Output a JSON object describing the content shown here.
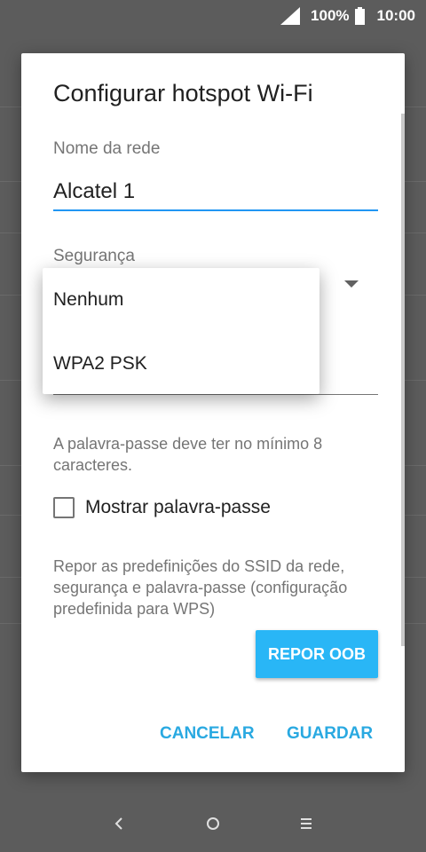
{
  "status_bar": {
    "battery_percent": "100%",
    "time": "10:00",
    "icons": [
      "signal-icon",
      "battery-icon"
    ]
  },
  "dialog": {
    "title": "Configurar hotspot Wi-Fi",
    "network_name": {
      "label": "Nome da rede",
      "value": "Alcatel 1"
    },
    "security": {
      "label": "Segurança",
      "options": [
        "Nenhum",
        "WPA2 PSK"
      ]
    },
    "password_hint": "A palavra-passe deve ter no mínimo 8 caracteres.",
    "show_password_label": "Mostrar palavra-passe",
    "show_password_checked": false,
    "reset_description": "Repor as predefinições do SSID da rede, segurança e palavra-passe (configuração predefinida para WPS)",
    "reset_button": "REPOR OOB",
    "cancel_button": "CANCELAR",
    "save_button": "GUARDAR"
  },
  "colors": {
    "accent": "#2196f3",
    "button": "#29b6f6",
    "scrim": "#5c5c5c"
  },
  "nav_bar": {
    "icons": [
      "back-icon",
      "home-icon",
      "recents-icon"
    ]
  }
}
